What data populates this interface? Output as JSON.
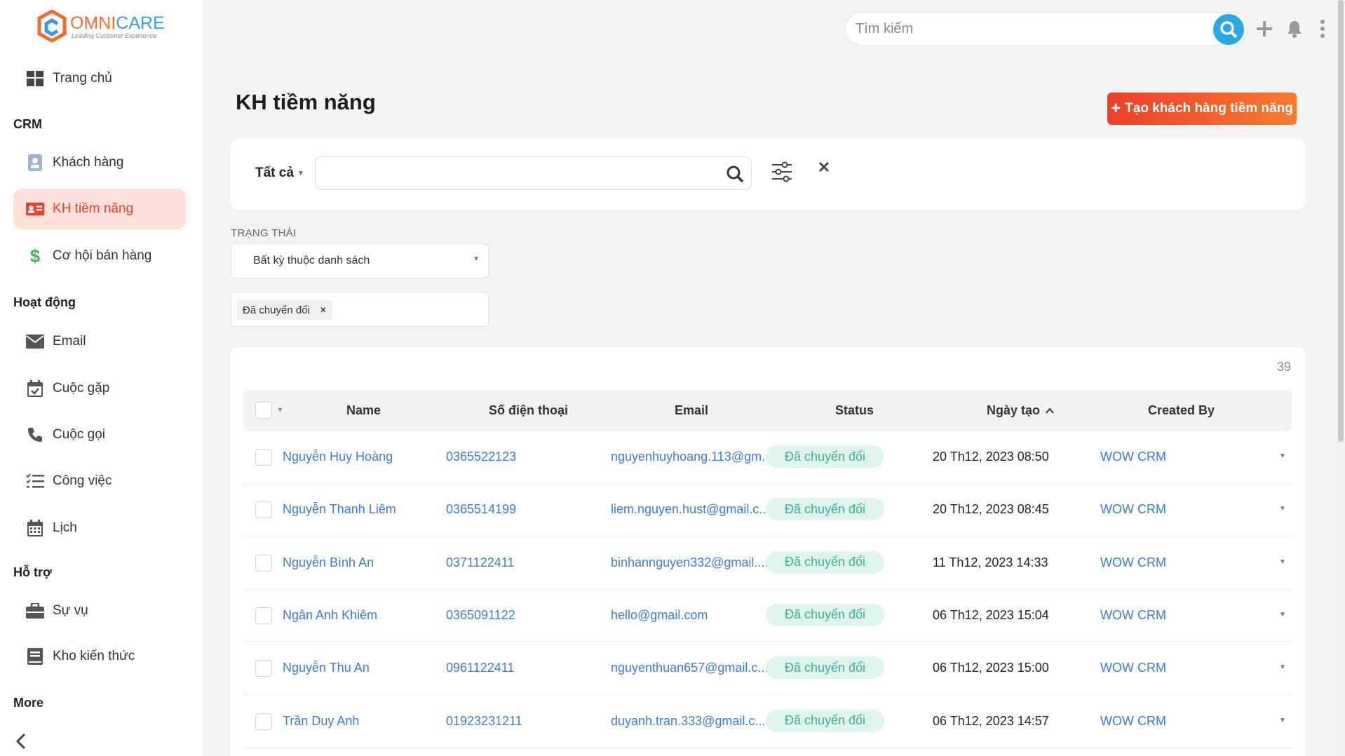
{
  "brand": {
    "name_part1": "OMNI",
    "name_part2": "CARE",
    "tagline": "Leading Customer Experience"
  },
  "sidebar": {
    "home": "Trang chủ",
    "sections": {
      "crm": "CRM",
      "activities": "Hoạt động",
      "support": "Hỗ trợ",
      "more": "More"
    },
    "items": {
      "customers": "Khách hàng",
      "leads": "KH tiềm năng",
      "opportunities": "Cơ hội bán hàng",
      "email": "Email",
      "meetings": "Cuộc gặp",
      "calls": "Cuộc gọi",
      "tasks": "Công việc",
      "calendar": "Lịch",
      "cases": "Sự vụ",
      "knowledge": "Kho kiến thức"
    }
  },
  "topbar": {
    "search_placeholder": "Tìm kiếm"
  },
  "page": {
    "title": "KH tiềm năng",
    "create_button": "Tạo khách hàng tiềm năng"
  },
  "filter": {
    "scope": "Tất cả",
    "status_label": "TRẠNG THÁI",
    "status_select": "Bất kỳ thuộc danh sách",
    "tag": "Đã chuyển đổi"
  },
  "table": {
    "count": "39",
    "columns": {
      "name": "Name",
      "phone": "Số điện thoại",
      "email": "Email",
      "status": "Status",
      "created": "Ngày tạo",
      "created_by": "Created By"
    },
    "rows": [
      {
        "name": "Nguyễn Huy Hoàng",
        "phone": "0365522123",
        "email": "nguyenhuyhoang.113@gm...",
        "status": "Đã chuyển đổi",
        "created": "20 Th12, 2023 08:50",
        "created_by": "WOW CRM"
      },
      {
        "name": "Nguyễn Thanh Liêm",
        "phone": "0365514199",
        "email": "liem.nguyen.hust@gmail.c...",
        "status": "Đã chuyển đổi",
        "created": "20 Th12, 2023 08:45",
        "created_by": "WOW CRM"
      },
      {
        "name": "Nguyễn Bình An",
        "phone": "0371122411",
        "email": "binhannguyen332@gmail....",
        "status": "Đã chuyển đổi",
        "created": "11 Th12, 2023 14:33",
        "created_by": "WOW CRM"
      },
      {
        "name": "Ngân Anh Khiêm",
        "phone": "0365091122",
        "email": "hello@gmail.com",
        "status": "Đã chuyển đổi",
        "created": "06 Th12, 2023 15:04",
        "created_by": "WOW CRM"
      },
      {
        "name": "Nguyễn Thu An",
        "phone": "0961122411",
        "email": "nguyenthuan657@gmail.c...",
        "status": "Đã chuyển đổi",
        "created": "06 Th12, 2023 15:00",
        "created_by": "WOW CRM"
      },
      {
        "name": "Trần Duy Anh",
        "phone": "01923231211",
        "email": "duyanh.tran.333@gmail.c...",
        "status": "Đã chuyển đổi",
        "created": "06 Th12, 2023 14:57",
        "created_by": "WOW CRM"
      }
    ]
  },
  "colors": {
    "accent": "#e8402b",
    "link": "#3b7bd4",
    "badge_bg": "#dff4ee",
    "badge_text": "#3cb491",
    "search_button": "#2aa7e6"
  }
}
